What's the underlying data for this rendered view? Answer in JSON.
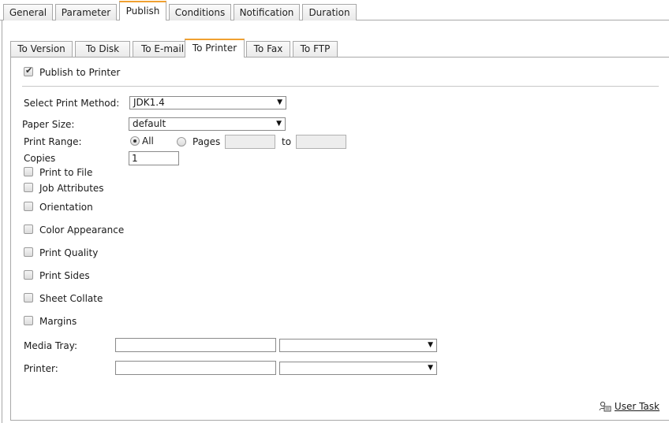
{
  "top_tabs": [
    "General",
    "Parameter",
    "Publish",
    "Conditions",
    "Notification",
    "Duration"
  ],
  "sub_tabs": [
    "To Version",
    "To Disk",
    "To E-mail",
    "To Printer",
    "To Fax",
    "To FTP"
  ],
  "publish_to_printer": {
    "label": "Publish to Printer",
    "checked": true
  },
  "print_method": {
    "label": "Select Print Method:",
    "value": "JDK1.4"
  },
  "paper_size": {
    "label": "Paper Size:",
    "value": "default"
  },
  "print_range": {
    "label": "Print Range:",
    "all_label": "All",
    "pages_label": "Pages",
    "to_label": "to",
    "selected": "All",
    "from": "",
    "to": ""
  },
  "copies": {
    "label": "Copies",
    "value": "1"
  },
  "options": {
    "print_to_file": "Print to File",
    "job_attributes": "Job Attributes",
    "orientation": "Orientation",
    "color_appearance": "Color Appearance",
    "print_quality": "Print Quality",
    "print_sides": "Print Sides",
    "sheet_collate": "Sheet Collate",
    "margins": "Margins"
  },
  "media_tray": {
    "label": "Media Tray:",
    "text": "",
    "select": ""
  },
  "printer": {
    "label": "Printer:",
    "text": "",
    "select": ""
  },
  "user_task": {
    "label": "User Task",
    "icon": "user-task-icon"
  },
  "colors": {
    "active_tab_accent": "#f0a030",
    "border": "#a8a8a8"
  }
}
